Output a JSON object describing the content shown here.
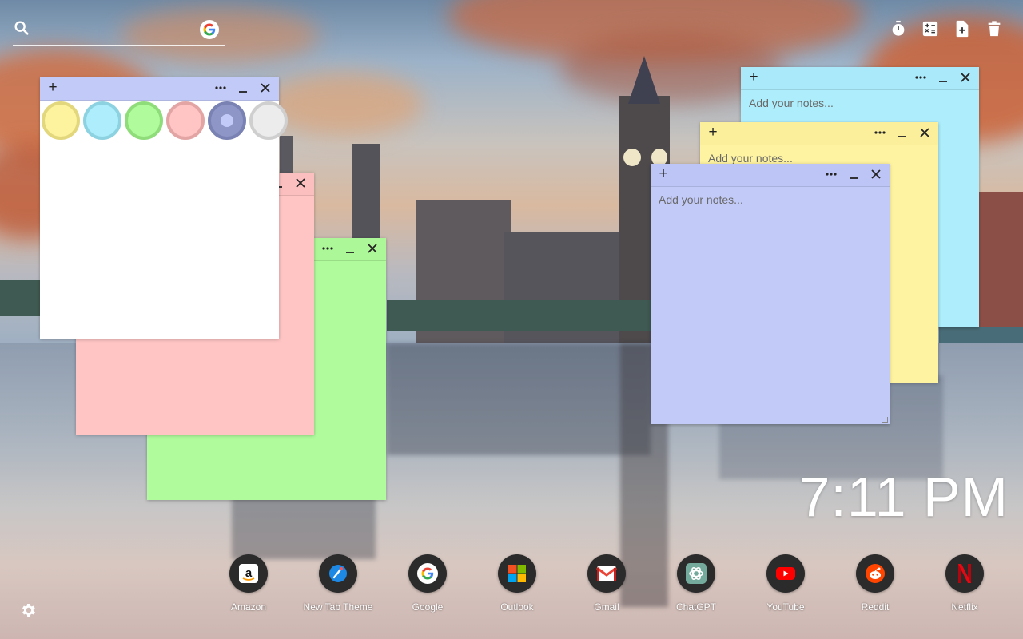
{
  "search": {
    "placeholder": "",
    "icon": "search-icon",
    "engine_icon": "google-icon"
  },
  "toolbar": {
    "items": [
      {
        "name": "timer-button",
        "icon": "timer-icon"
      },
      {
        "name": "calculator-button",
        "icon": "calculator-icon"
      },
      {
        "name": "new-note-button",
        "icon": "note-add-icon"
      },
      {
        "name": "delete-all-button",
        "icon": "trash-icon"
      }
    ]
  },
  "colors": {
    "yellow": "#fef3a0",
    "blue": "#aeeefc",
    "green": "#b0fb9c",
    "pink": "#ffc4c4",
    "lavender": "#c2caf8",
    "gray": "#e9e9e9",
    "head_yellow": "#fbef9b",
    "head_blue": "#a9e9fa",
    "head_lavender": "#bcc5f5"
  },
  "notes": [
    {
      "color": "blue",
      "placeholder": "Add your notes...",
      "value": ""
    },
    {
      "color": "yellow",
      "placeholder": "Add your notes...",
      "value": ""
    },
    {
      "color": "lavender",
      "placeholder": "Add your notes...",
      "value": ""
    },
    {
      "color": "green",
      "placeholder": "",
      "value": ""
    },
    {
      "color": "pink",
      "placeholder": "",
      "value": ""
    },
    {
      "color": "white",
      "placeholder": "",
      "value": "",
      "color_picker_open": true,
      "swatches": [
        "yellow",
        "blue",
        "green",
        "pink",
        "lavender",
        "gray"
      ],
      "selected_swatch": "lavender"
    }
  ],
  "note_controls": {
    "add": "+",
    "more": "more-icon",
    "minimize": "minimize-icon",
    "close": "close-icon"
  },
  "clock": {
    "time": "7:11 PM"
  },
  "shortcuts": [
    {
      "label": "Amazon",
      "icon": "amazon-icon"
    },
    {
      "label": "New Tab Theme",
      "icon": "new-tab-theme-icon"
    },
    {
      "label": "Google",
      "icon": "google-icon"
    },
    {
      "label": "Outlook",
      "icon": "microsoft-icon"
    },
    {
      "label": "Gmail",
      "icon": "gmail-icon"
    },
    {
      "label": "ChatGPT",
      "icon": "chatgpt-icon"
    },
    {
      "label": "YouTube",
      "icon": "youtube-icon"
    },
    {
      "label": "Reddit",
      "icon": "reddit-icon"
    },
    {
      "label": "Netflix",
      "icon": "netflix-icon"
    }
  ],
  "settings": {
    "icon": "gear-icon"
  }
}
